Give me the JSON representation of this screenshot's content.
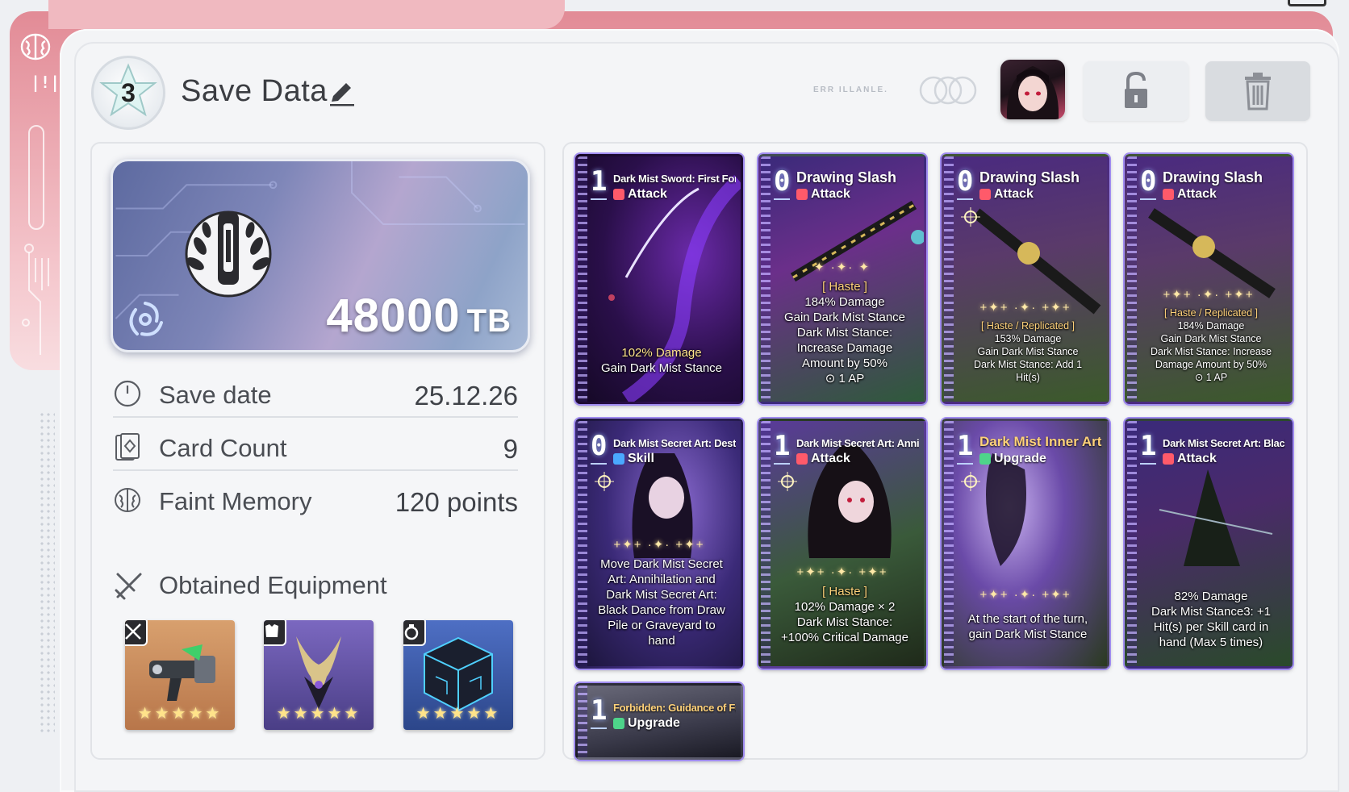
{
  "header": {
    "slot_number": "3",
    "title": "Save Data",
    "tiny_text": "ERR ILLANLE."
  },
  "summary": {
    "tb_value": "48000",
    "tb_unit": "TB",
    "rows": [
      {
        "label": "Save date",
        "value": "25.12.26"
      },
      {
        "label": "Card Count",
        "value": "9"
      },
      {
        "label": "Faint Memory",
        "value": "120 points"
      }
    ],
    "equipment_title": "Obtained Equipment",
    "equipment": [
      {
        "slot": "weapon",
        "stars": "★★★★★",
        "color": "#c98a5b"
      },
      {
        "slot": "armor",
        "stars": "★★★★★",
        "color": "#6b5aa8"
      },
      {
        "slot": "accessory",
        "stars": "★★★★★",
        "color": "#3a5aa6"
      }
    ]
  },
  "cards": [
    {
      "cost": "1",
      "name": "Dark Mist Sword: First Form",
      "type": "Attack",
      "sparkle": "",
      "desc": [
        "102% Damage",
        "Gain Dark Mist Stance"
      ]
    },
    {
      "cost": "0",
      "name": "Drawing Slash",
      "type": "Attack",
      "sparkle": "✦ ·✦· ✦",
      "desc": [
        "[ Haste ]",
        "184% Damage",
        "Gain Dark Mist Stance",
        "Dark Mist Stance:",
        "Increase Damage",
        "Amount by 50%",
        "1 AP"
      ]
    },
    {
      "cost": "0",
      "name": "Drawing Slash",
      "type": "Attack",
      "sparkle": "+✦+ ·✦· +✦+",
      "desc": [
        "[ Haste / Replicated ]",
        "153% Damage",
        "Gain Dark Mist Stance",
        "Dark Mist Stance: Add 1",
        "Hit(s)"
      ]
    },
    {
      "cost": "0",
      "name": "Drawing Slash",
      "type": "Attack",
      "sparkle": "+✦+ ·✦· +✦+",
      "desc": [
        "[ Haste / Replicated ]",
        "184% Damage",
        "Gain Dark Mist Stance",
        "Dark Mist Stance: Increase",
        "Damage Amount by 50%",
        "1 AP"
      ]
    },
    {
      "cost": "0",
      "name": "Dark Mist Secret Art: Destruction",
      "type": "Skill",
      "sparkle": "+✦+ ·✦· +✦+",
      "desc": [
        "Move Dark Mist Secret",
        "Art: Annihilation and",
        "Dark Mist Secret Art:",
        "Black Dance from Draw",
        "Pile or Graveyard to",
        "hand"
      ]
    },
    {
      "cost": "1",
      "name": "Dark Mist Secret Art: Annihilation",
      "type": "Attack",
      "sparkle": "+✦+ ·✦· +✦+",
      "desc": [
        "[ Haste ]",
        "102% Damage × 2",
        "Dark Mist Stance:",
        "+100% Critical Damage"
      ]
    },
    {
      "cost": "1",
      "name": "Dark Mist Inner Art",
      "type": "Upgrade",
      "sparkle": "+✦+ ·✦· +✦+",
      "desc": [
        "At the start of the turn,",
        "gain Dark Mist Stance"
      ]
    },
    {
      "cost": "1",
      "name": "Dark Mist Secret Art: Black Dance",
      "type": "Attack",
      "sparkle": "",
      "desc": [
        "82% Damage",
        "Dark Mist Stance3: +1",
        "Hit(s) per Skill card in",
        "hand (Max 5 times)"
      ]
    },
    {
      "cost": "1",
      "name": "Forbidden: Guidance of Futility",
      "type": "Upgrade",
      "sparkle": "",
      "desc": []
    }
  ],
  "colors": {
    "frame_pink": "#e28b96",
    "panel": "#f3f4f6",
    "card_border": "#a08cf0"
  }
}
